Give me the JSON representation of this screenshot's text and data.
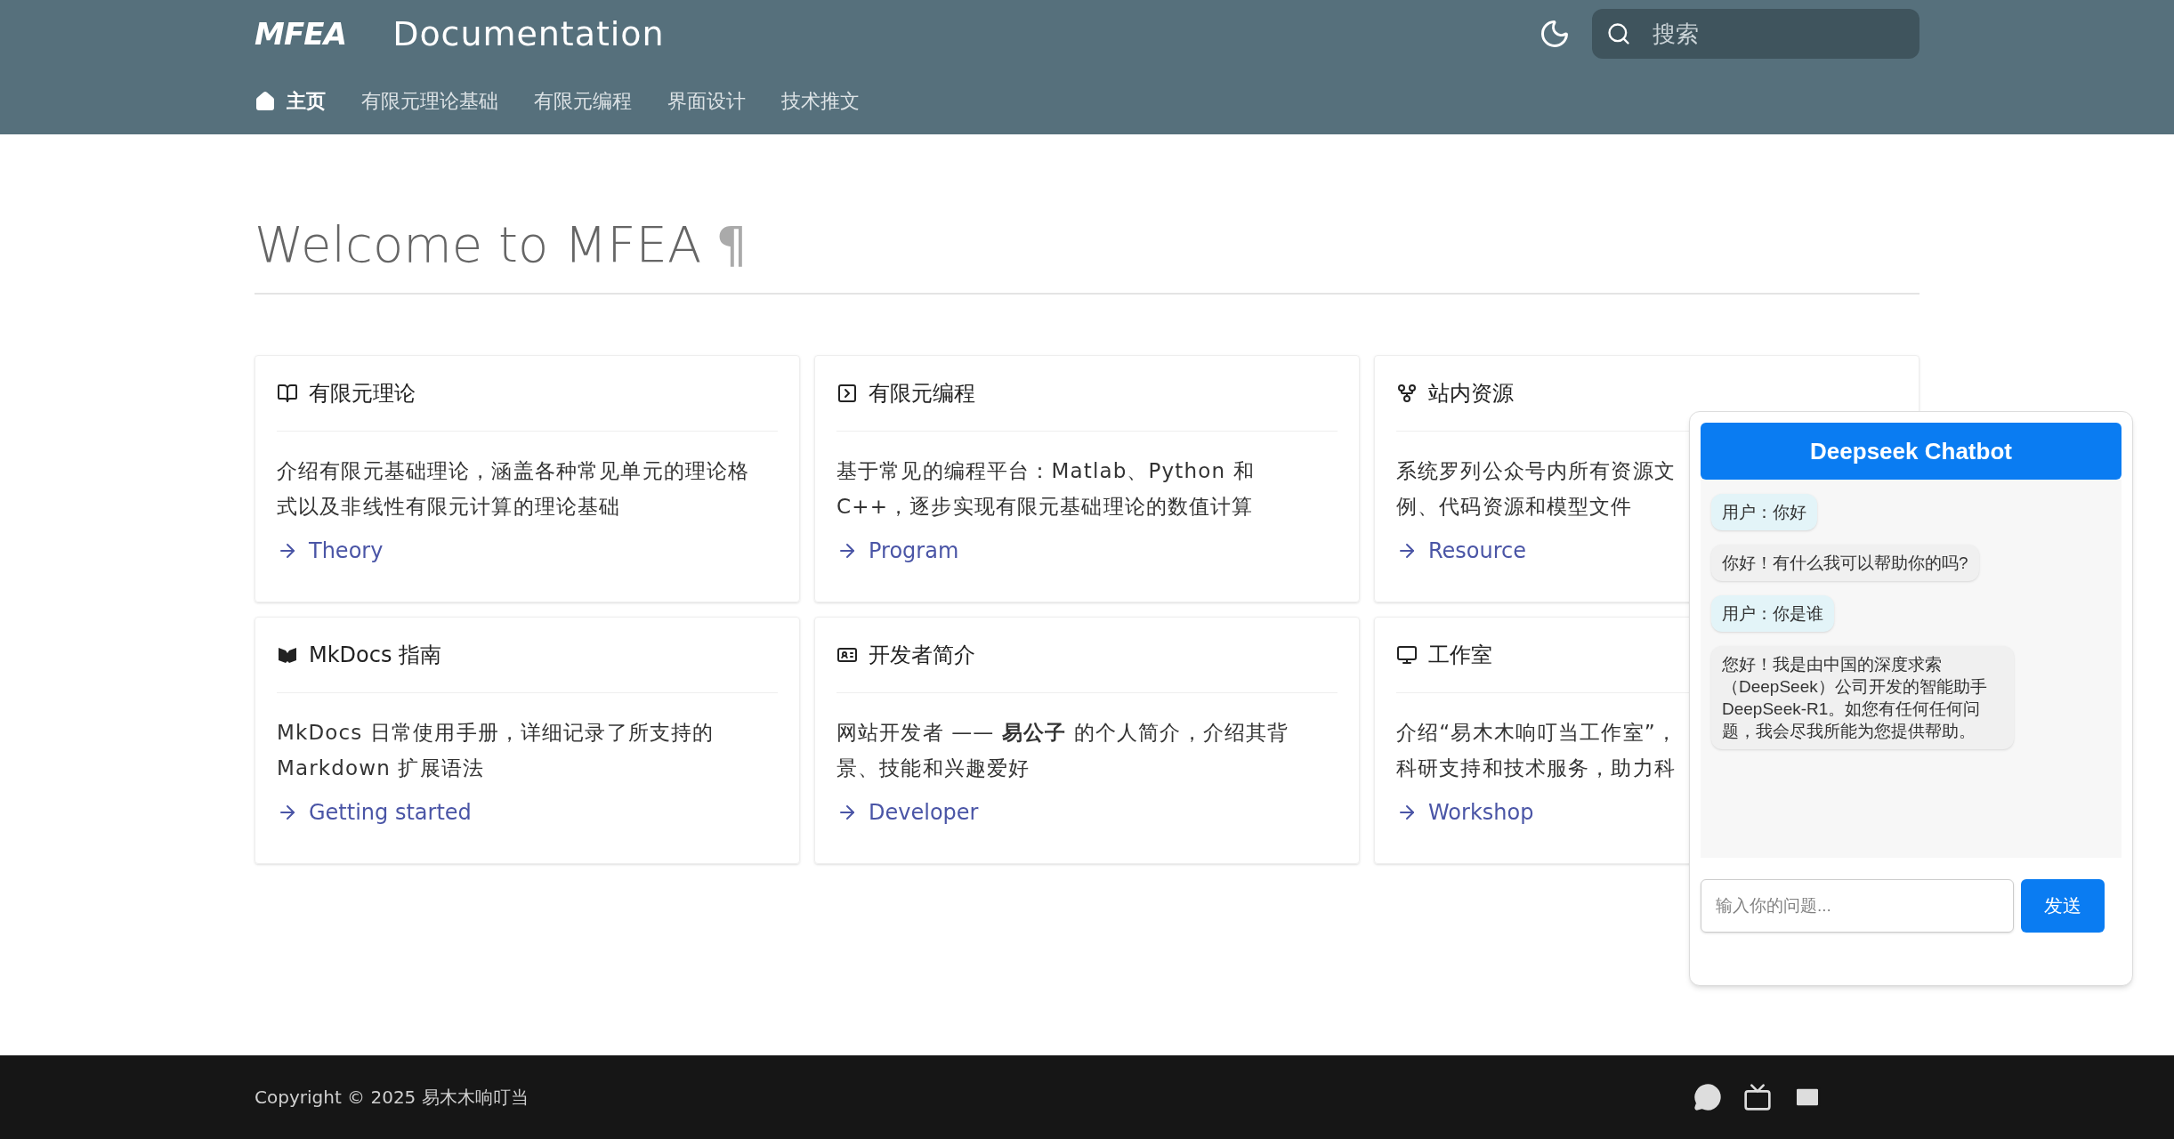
{
  "header": {
    "logo": "MFEA",
    "title": "Documentation",
    "search": {
      "placeholder": "搜索"
    }
  },
  "nav": [
    {
      "label": "主页",
      "selected": true,
      "kind": "home"
    },
    {
      "label": "有限元理论基础",
      "selected": false
    },
    {
      "label": "有限元编程",
      "selected": false
    },
    {
      "label": "界面设计",
      "selected": false
    },
    {
      "label": "技术推文",
      "selected": false
    }
  ],
  "heading": {
    "text": "Welcome to MFEA",
    "anchor": "¶"
  },
  "cards": [
    {
      "kind": "book",
      "title": "有限元理论",
      "lines": [
        "介绍有限元基础理论，涵盖各种常见单元的理论格式以及非线性有限元计算的理论基础"
      ],
      "link": "Theory"
    },
    {
      "kind": "terminal",
      "title": "有限元编程",
      "lines": [
        "基于常见的编程平台：Matlab、Python 和 C++，逐步实现有限元基础理论的数值计算"
      ],
      "link": "Program"
    },
    {
      "kind": "fork",
      "title": "站内资源",
      "lines": [
        "系统罗列公众号内所有资源文",
        "例、代码资源和模型文件"
      ],
      "link": "Resource"
    },
    {
      "kind": "mkdocs",
      "title": "MkDocs 指南",
      "lines": [
        "MkDocs 日常使用手册，详细记录了所支持的 Markdown 扩展语法"
      ],
      "link": "Getting started"
    },
    {
      "kind": "idcard",
      "title": "开发者简介",
      "lines": [
        "网站开发者 —— **易公子** 的个人简介，介绍其背景、技能和兴趣爱好"
      ],
      "link": "Developer"
    },
    {
      "kind": "monitor",
      "title": "工作室",
      "lines": [
        "介绍“易木木响叮当工作室”，",
        "科研支持和技术服务，助力科"
      ],
      "link": "Workshop"
    }
  ],
  "chatbot": {
    "title": "Deepseek Chatbot",
    "messages": [
      {
        "kind": "user",
        "text": "用户：你好"
      },
      {
        "kind": "bot",
        "text": "你好！有什么我可以帮助你的吗?"
      },
      {
        "kind": "user",
        "text": "用户：你是谁"
      },
      {
        "kind": "bot",
        "text": "您好！我是由中国的深度求索（DeepSeek）公司开发的智能助手DeepSeek-R1。如您有任何任何问题，我会尽我所能为您提供帮助。"
      }
    ],
    "input": {
      "placeholder": "输入你的问题..."
    },
    "send": "发送"
  },
  "footer": {
    "copyright": "Copyright © 2025 易木木响叮当"
  }
}
